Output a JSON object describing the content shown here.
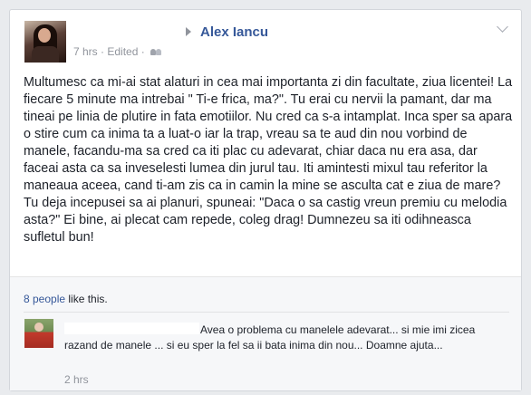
{
  "post": {
    "recipient": "Alex Iancu",
    "timestamp": "7 hrs",
    "edited": "Edited",
    "separator": "·",
    "privacy_icon": "friends-icon",
    "text": "Multumesc ca mi-ai stat alaturi in cea mai importanta zi din facultate, ziua licentei! La fiecare 5 minute ma intrebai \" Ti-e frica, ma?\". Tu erai cu nervii la pamant, dar ma tineai pe linia de plutire in fata emotiilor. Nu cred ca s-a intamplat. Inca sper sa apara o stire cum ca inima ta a luat-o iar la trap, vreau sa te aud din nou vorbind de manele, facandu-ma sa cred ca iti plac cu adevarat, chiar daca nu era asa, dar faceai asta ca sa inveselesti lumea din jurul tau. Iti amintesti mixul tau referitor la maneaua aceea, cand ti-am zis ca in camin la mine se asculta cat e ziua de mare? Tu deja incepusei sa ai planuri, spuneai: \"Daca o sa castig vreun premiu cu melodia asta?\" Ei bine, ai plecat cam repede, coleg drag! Dumnezeu sa iti odihneasca sufletul bun!"
  },
  "likes": {
    "count_link": "8 people",
    "suffix": " like this."
  },
  "comment": {
    "text": "Avea o problema cu manelele adevarat... si mie imi zicea razand de manele ... si eu sper la fel sa ii bata inima din nou... Doamne ajuta...",
    "time": "2 hrs"
  },
  "colors": {
    "link": "#365899",
    "meta": "#90949c",
    "text": "#1d2129",
    "footer_bg": "#f6f7f9"
  }
}
